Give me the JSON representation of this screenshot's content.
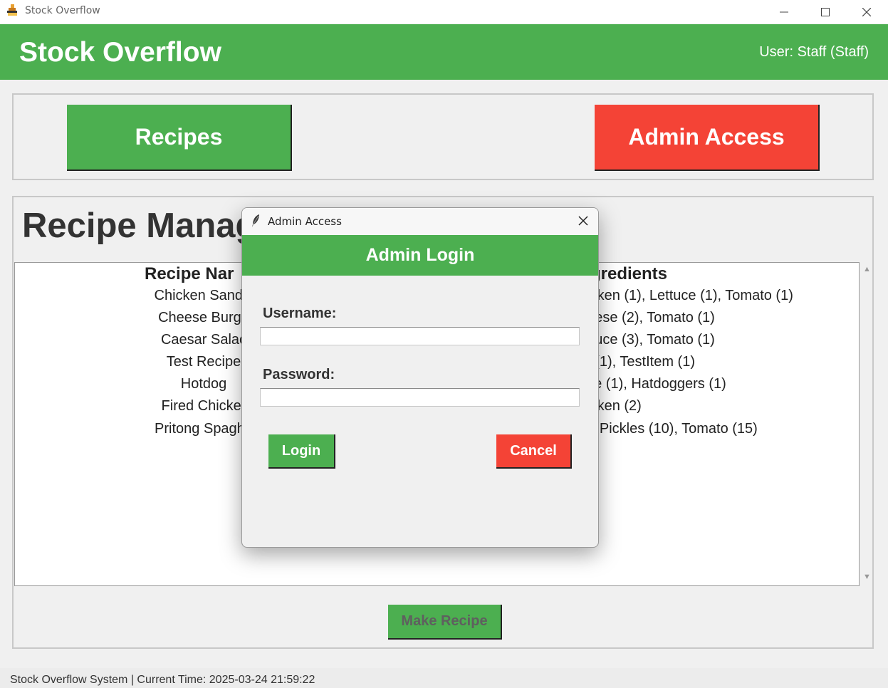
{
  "window": {
    "title": "Stock Overflow"
  },
  "header": {
    "title": "Stock Overflow",
    "user": "User: Staff (Staff)"
  },
  "nav": {
    "recipes_label": "Recipes",
    "admin_label": "Admin Access"
  },
  "recipes": {
    "heading": "Recipe Manag",
    "columns": {
      "name": "Recipe Nar",
      "ingredients": "gredients"
    },
    "rows": [
      {
        "name": "Chicken Sandw",
        "ingredients": "hicken (1), Lettuce (1), Tomato (1)"
      },
      {
        "name": "Cheese Burge",
        "ingredients": "heese (2), Tomato (1)"
      },
      {
        "name": "Caesar Salac",
        "ingredients": "ettuce (3), Tomato (1)"
      },
      {
        "name": "Test Recipe",
        "ingredients": "rs (1), TestItem (1)"
      },
      {
        "name": "Hotdog",
        "ingredients": "ese (1), Hatdoggers (1)"
      },
      {
        "name": "Fired Chicker",
        "ingredients": "hicken (2)"
      },
      {
        "name": "Pritong Spaghe",
        "ingredients": "5), Pickles (10), Tomato (15)"
      }
    ],
    "make_label": "Make Recipe"
  },
  "status": {
    "text": "Stock Overflow System | Current Time: 2025-03-24 21:59:22"
  },
  "dialog": {
    "window_title": "Admin Access",
    "header": "Admin Login",
    "username_label": "Username:",
    "username_value": "",
    "password_label": "Password:",
    "password_value": "",
    "login_label": "Login",
    "cancel_label": "Cancel"
  },
  "colors": {
    "green": "#4caf50",
    "red": "#f44336"
  },
  "icons": {
    "app": "stock-overflow-icon",
    "minimize": "minimize-icon",
    "maximize": "maximize-icon",
    "close": "close-icon",
    "dialog": "feather-icon",
    "scroll_up": "arrow-up-icon",
    "scroll_down": "arrow-down-icon"
  }
}
